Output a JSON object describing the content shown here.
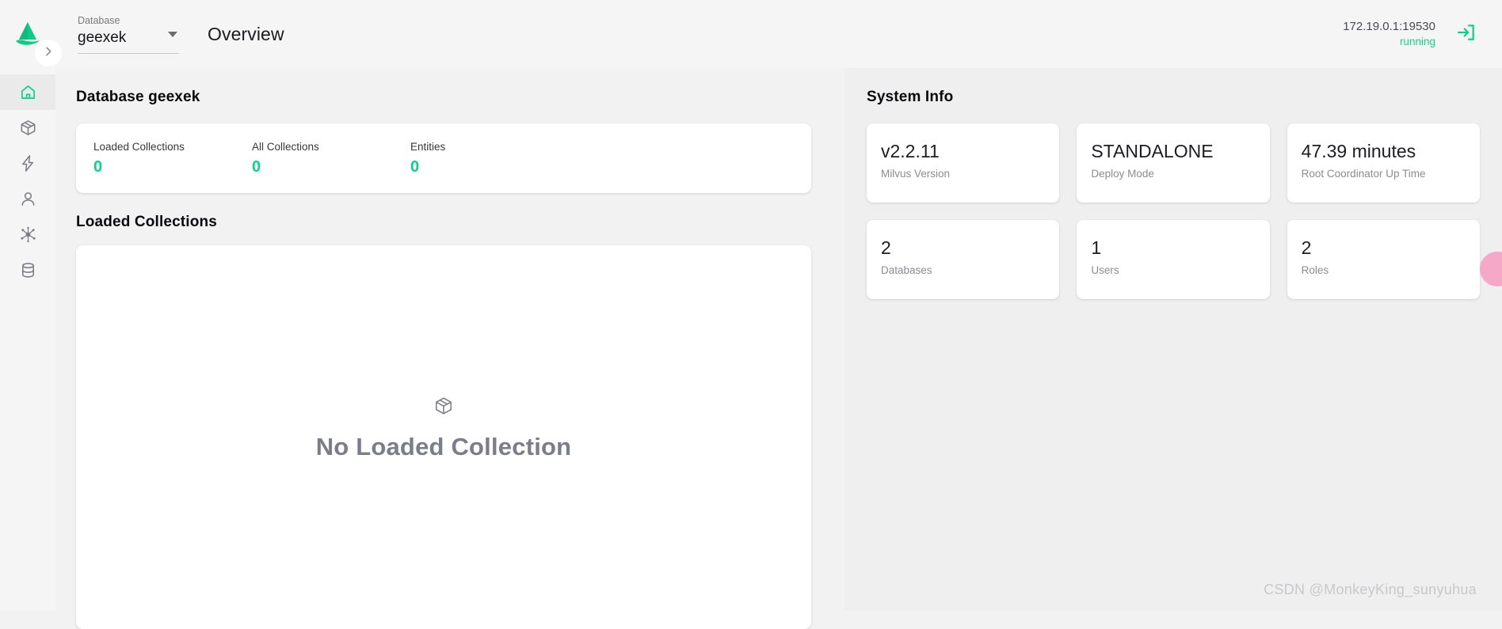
{
  "header": {
    "logo_icon": "milvus-logo-icon",
    "database_select": {
      "label": "Database",
      "value": "geexek",
      "caret_icon": "chevron-down-icon"
    },
    "page_title": "Overview",
    "connection": {
      "address": "172.19.0.1:19530",
      "status": "running"
    },
    "exit_icon": "exit-logout-icon"
  },
  "sidebar": {
    "expander_icon": "chevron-right-icon",
    "items": [
      {
        "name": "home",
        "icon": "home-icon",
        "active": true
      },
      {
        "name": "collections",
        "icon": "box-icon",
        "active": false
      },
      {
        "name": "vector-search",
        "icon": "lightning-bolt-icon",
        "active": false
      },
      {
        "name": "users",
        "icon": "person-icon",
        "active": false
      },
      {
        "name": "cluster",
        "icon": "network-nodes-icon",
        "active": false
      },
      {
        "name": "databases",
        "icon": "database-cylinder-icon",
        "active": false
      }
    ]
  },
  "left_panel": {
    "database_heading": "Database geexek",
    "stats": [
      {
        "label": "Loaded Collections",
        "value": "0"
      },
      {
        "label": "All Collections",
        "value": "0"
      },
      {
        "label": "Entities",
        "value": "0"
      }
    ],
    "loaded_collections_heading": "Loaded Collections",
    "empty_state": {
      "icon": "box-icon",
      "text": "No Loaded Collection"
    }
  },
  "right_panel": {
    "heading": "System Info",
    "cards": [
      {
        "value": "v2.2.11",
        "label": "Milvus Version"
      },
      {
        "value": "STANDALONE",
        "label": "Deploy Mode"
      },
      {
        "value": "47.39 minutes",
        "label": "Root Coordinator Up Time"
      },
      {
        "value": "2",
        "label": "Databases"
      },
      {
        "value": "1",
        "label": "Users"
      },
      {
        "value": "2",
        "label": "Roles"
      }
    ]
  },
  "overlays": {
    "watermark": "CSDN @MonkeyKing_sunyuhua",
    "fab_color": "#f6a8c8"
  },
  "colors": {
    "accent_green": "#06d68c",
    "page_bg": "#f2f2f2",
    "panel_bg": "#efefef",
    "card_bg": "#ffffff"
  }
}
